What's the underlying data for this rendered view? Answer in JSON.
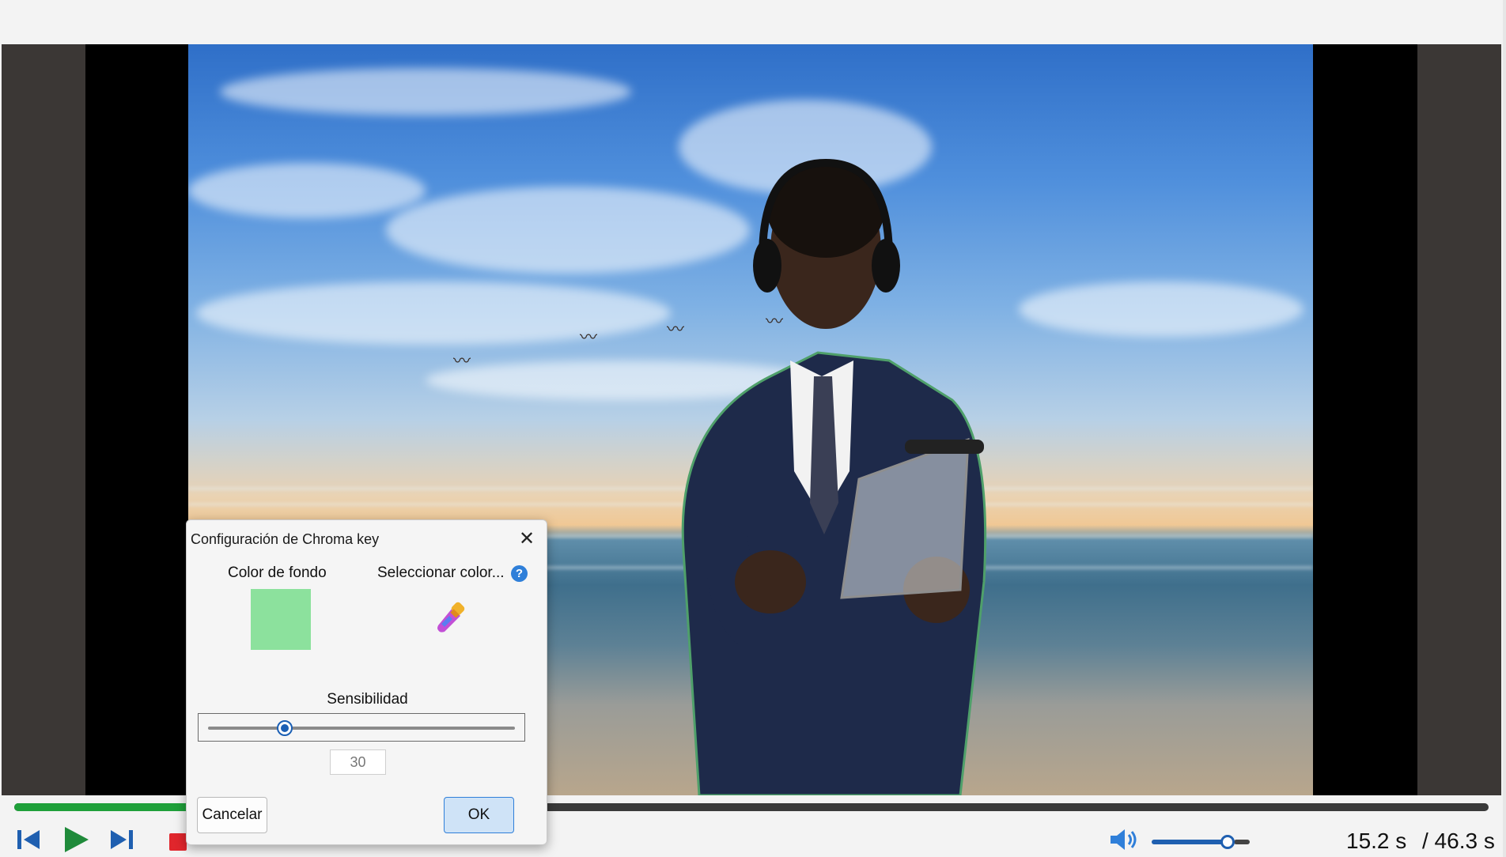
{
  "colors": {
    "accent": "#1fa03a",
    "volume": "#1f5fb0",
    "chroma_key_color": "#8ce19d",
    "stop": "#e0262c"
  },
  "player": {
    "progress_fraction": 0.12,
    "current_time": "15.2 s",
    "total_time": "/ 46.3 s",
    "volume_fraction": 0.78,
    "icons": [
      "skip-back-icon",
      "play-icon",
      "skip-forward-icon",
      "stop-icon",
      "volume-icon"
    ]
  },
  "dialog": {
    "title": "Configuración de Chroma key",
    "background_color_label": "Color de fondo",
    "select_color_label": "Seleccionar color...",
    "help_glyph": "?",
    "sensitivity_label": "Sensibilidad",
    "sensitivity_value": "30",
    "sensitivity_fraction": 0.25,
    "cancel_label": "Cancelar",
    "ok_label": "OK",
    "icons": [
      "close-icon",
      "help-icon",
      "eyedropper-icon"
    ]
  }
}
